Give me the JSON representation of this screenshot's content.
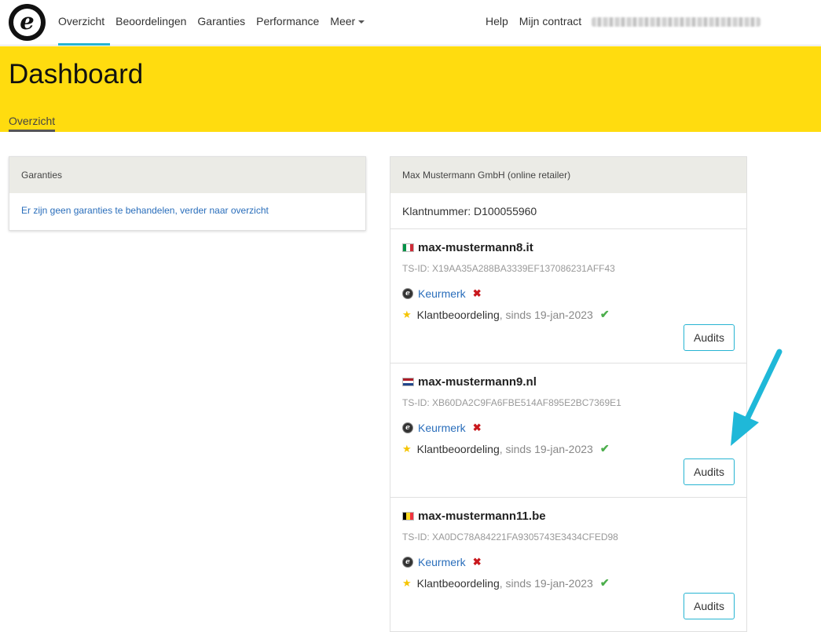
{
  "nav": {
    "logo": "e",
    "items": [
      "Overzicht",
      "Beoordelingen",
      "Garanties",
      "Performance",
      "Meer"
    ],
    "help": "Help",
    "contract": "Mijn contract",
    "accent_color": "#27b4d2"
  },
  "header": {
    "title": "Dashboard",
    "tab": "Overzicht",
    "background": "#ffdc0f"
  },
  "garanties": {
    "heading": "Garanties",
    "message": "Er zijn geen garanties te behandelen, verder naar overzicht"
  },
  "retailer": {
    "heading": "Max Mustermann GmbH (online retailer)",
    "customer_number": "Klantnummer: D100055960",
    "shops": [
      {
        "flag": "it",
        "name": "max-mustermann8.it",
        "ts_id": "TS-ID: X19AA35A288BA3339EF137086231AFF43",
        "keurmerk": "Keurmerk",
        "review_label": "Klantbeoordeling",
        "review_since": ", sinds 19-jan-2023",
        "button": "Audits"
      },
      {
        "flag": "nl",
        "name": "max-mustermann9.nl",
        "ts_id": "TS-ID: XB60DA2C9FA6FBE514AF895E2BC7369E1",
        "keurmerk": "Keurmerk",
        "review_label": "Klantbeoordeling",
        "review_since": ", sinds 19-jan-2023",
        "button": "Audits"
      },
      {
        "flag": "be",
        "name": "max-mustermann11.be",
        "ts_id": "TS-ID: XA0DC78A84221FA9305743E3434CFED98",
        "keurmerk": "Keurmerk",
        "review_label": "Klantbeoordeling",
        "review_since": ", sinds 19-jan-2023",
        "button": "Audits"
      }
    ]
  },
  "annotation_arrow_color": "#1fb8d8"
}
